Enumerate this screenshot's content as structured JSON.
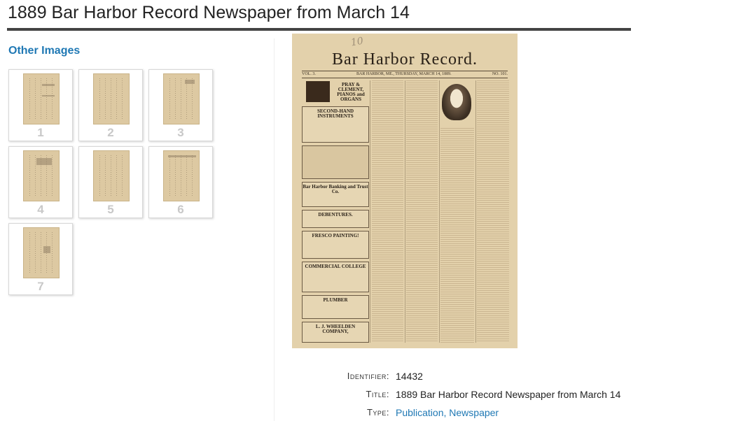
{
  "page": {
    "title": "1889 Bar Harbor Record Newspaper from March 14"
  },
  "sidebar": {
    "heading": "Other Images",
    "thumbnails": [
      {
        "number": "1"
      },
      {
        "number": "2"
      },
      {
        "number": "3"
      },
      {
        "number": "4"
      },
      {
        "number": "5"
      },
      {
        "number": "6"
      },
      {
        "number": "7"
      }
    ]
  },
  "newspaper": {
    "masthead": "Bar Harbor Record.",
    "dateline_left": "VOL. 3.",
    "dateline_center": "BAR HARBOR, ME., THURSDAY, MARCH 14, 1889.",
    "dateline_right": "NO. 101.",
    "ad_1": "PRAY & CLEMENT, PIANOS and ORGANS",
    "ad_2": "SECOND-HAND INSTRUMENTS",
    "ad_3": "Bar Harbor Banking and Trust Co.",
    "ad_4": "DEBENTURES.",
    "ad_5": "FRESCO PAINTING!",
    "ad_6": "COMMERCIAL COLLEGE",
    "ad_7": "PLUMBER",
    "ad_8": "L. J. WHEELDEN COMPANY,",
    "handwriting": "10"
  },
  "metadata": {
    "identifier_label": "Identifier:",
    "identifier_value": "14432",
    "title_label": "Title:",
    "title_value": "1889 Bar Harbor Record Newspaper from March 14",
    "type_label": "Type:",
    "type_value_1": "Publication",
    "type_separator": ", ",
    "type_value_2": "Newspaper"
  },
  "colors": {
    "link": "#1f78b4",
    "rule": "#444444",
    "paper": "#e3d1ab"
  }
}
